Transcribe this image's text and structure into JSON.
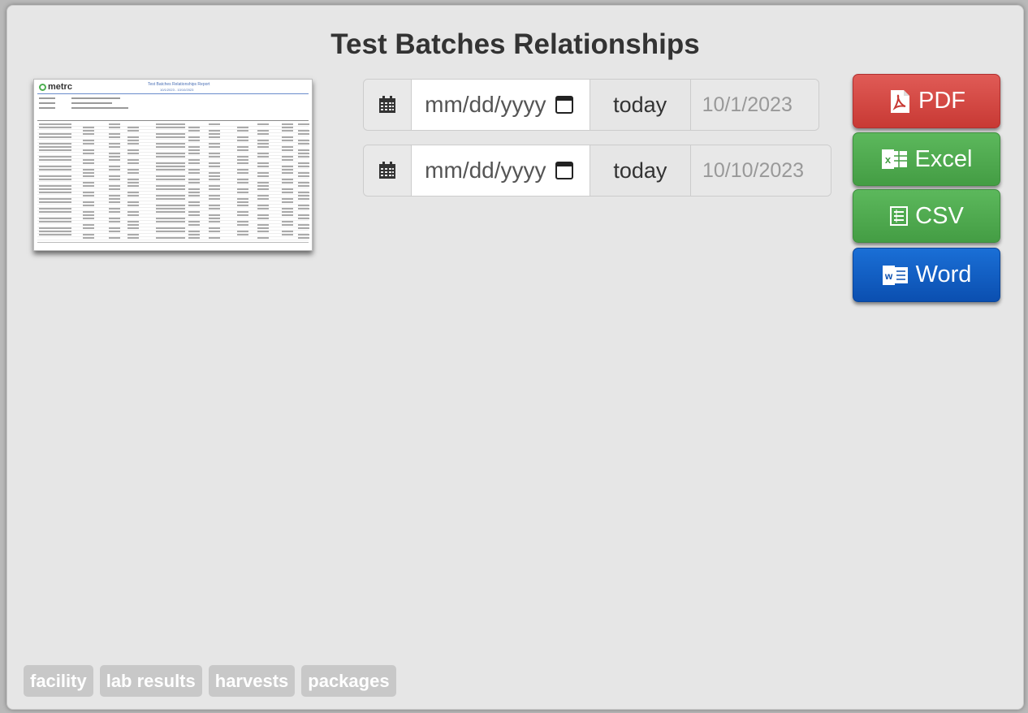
{
  "page": {
    "title": "Test Batches Relationships"
  },
  "thumbnail": {
    "logo_text": "metrc",
    "report_title": "Test Batches Relationships Report",
    "report_subtitle": "10/1/2023 - 10/10/2023"
  },
  "date_filters": [
    {
      "placeholder": "mm/dd/yyyy",
      "today_label": "today",
      "value": "10/1/2023"
    },
    {
      "placeholder": "mm/dd/yyyy",
      "today_label": "today",
      "value": "10/10/2023"
    }
  ],
  "export_buttons": [
    {
      "label": "PDF",
      "icon": "pdf-icon",
      "color": "#d9534f"
    },
    {
      "label": "Excel",
      "icon": "excel-icon",
      "color": "#5cb85c"
    },
    {
      "label": "CSV",
      "icon": "csv-icon",
      "color": "#5cb85c"
    },
    {
      "label": "Word",
      "icon": "word-icon",
      "color": "#0d5bc6"
    }
  ],
  "tags": [
    "facility",
    "lab results",
    "harvests",
    "packages"
  ]
}
